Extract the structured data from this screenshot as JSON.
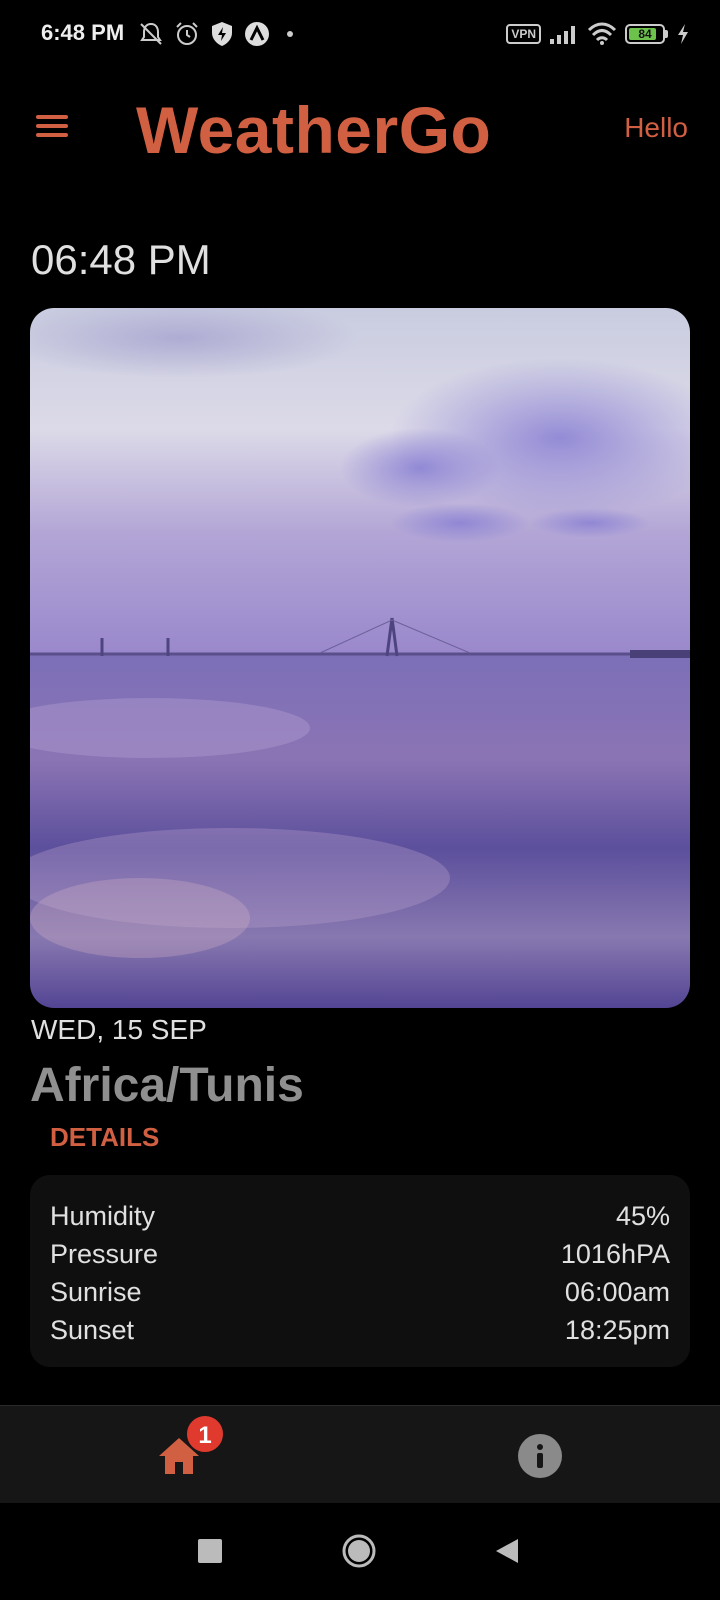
{
  "status_bar": {
    "time": "6:48 PM",
    "icons_left": [
      "mute-icon",
      "alarm-icon",
      "shield-bolt-icon",
      "app-a-icon",
      "dot-icon"
    ],
    "vpn_label": "VPN",
    "battery_level": "84",
    "battery_fraction": 0.84,
    "icons_right": [
      "vpn-icon",
      "signal-icon",
      "wifi-icon",
      "battery-icon",
      "charging-icon"
    ]
  },
  "header": {
    "app_title": "WeatherGo",
    "hello_label": "Hello",
    "menu_icon": "hamburger-menu-icon"
  },
  "main": {
    "time": "06:48 PM",
    "date": "WED, 15 SEP",
    "city": "Africa/Tunis",
    "details_label": "DETAILS",
    "details": [
      {
        "label": "Humidity",
        "value": "45%"
      },
      {
        "label": "Pressure",
        "value": "1016hPA"
      },
      {
        "label": "Sunrise",
        "value": "06:00am"
      },
      {
        "label": "Sunset",
        "value": "18:25pm"
      }
    ]
  },
  "bottom_nav": {
    "home_icon": "home-icon",
    "home_badge": "1",
    "info_icon": "info-icon"
  },
  "colors": {
    "accent": "#d15f42",
    "background": "#000000",
    "card": "#0f0f0f",
    "badge": "#e03a2f"
  }
}
